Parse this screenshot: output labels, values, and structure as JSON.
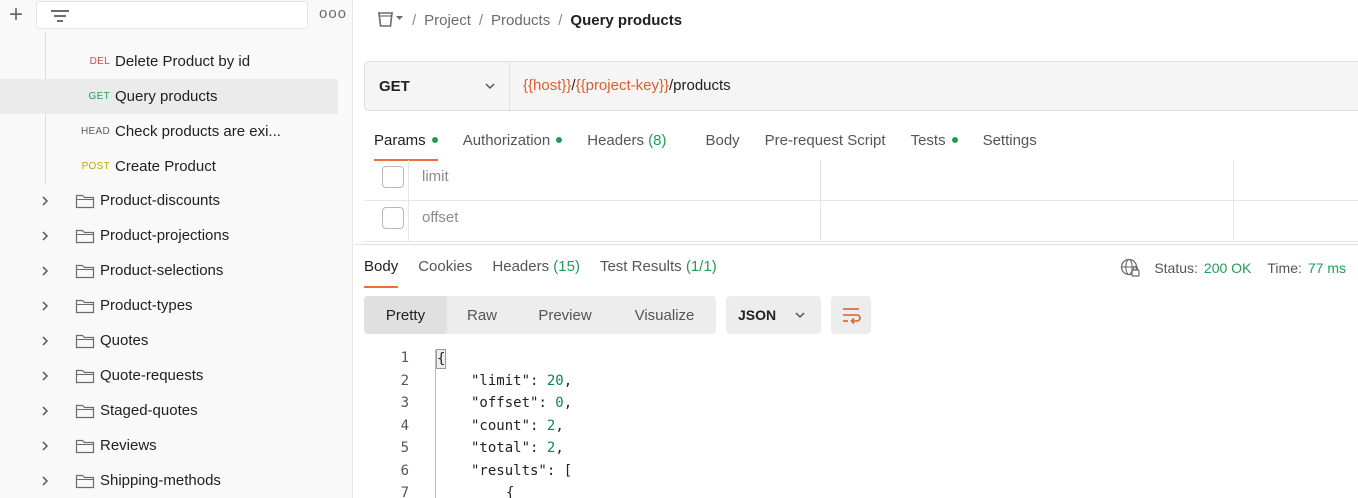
{
  "sidebar": {
    "requests": [
      {
        "method": "DEL",
        "name": "Delete Product by id"
      },
      {
        "method": "GET",
        "name": "Query products"
      },
      {
        "method": "HEAD",
        "name": "Check products are exi..."
      },
      {
        "method": "POST",
        "name": "Create Product"
      }
    ],
    "folders": [
      "Product-discounts",
      "Product-projections",
      "Product-selections",
      "Product-types",
      "Quotes",
      "Quote-requests",
      "Staged-quotes",
      "Reviews",
      "Shipping-methods"
    ]
  },
  "breadcrumb": {
    "items": [
      "Project",
      "Products"
    ],
    "current": "Query products",
    "sep": "/"
  },
  "request": {
    "method": "GET",
    "url_parts": [
      {
        "text": "{{host}}",
        "var": true
      },
      {
        "text": "/",
        "var": false
      },
      {
        "text": "{{project-key}}",
        "var": true
      },
      {
        "text": "/products",
        "var": false
      }
    ]
  },
  "request_tabs": {
    "params": "Params",
    "authorization": "Authorization",
    "headers": "Headers",
    "headers_count": "(8)",
    "body": "Body",
    "prerequest": "Pre-request Script",
    "tests": "Tests",
    "settings": "Settings"
  },
  "params": [
    {
      "key": "limit"
    },
    {
      "key": "offset"
    }
  ],
  "response_tabs": {
    "body": "Body",
    "cookies": "Cookies",
    "headers": "Headers",
    "headers_count": "(15)",
    "tests": "Test Results",
    "tests_count": "(1/1)"
  },
  "status": {
    "status_label": "Status:",
    "status_value": "200 OK",
    "time_label": "Time:",
    "time_value": "77 ms"
  },
  "view_tabs": [
    "Pretty",
    "Raw",
    "Preview",
    "Visualize"
  ],
  "format": "JSON",
  "code": {
    "line_numbers": [
      "1",
      "2",
      "3",
      "4",
      "5",
      "6",
      "7"
    ],
    "brace_open": "{",
    "lines": [
      {
        "key": "\"limit\"",
        "sep": ": ",
        "val": "20",
        "tail": ","
      },
      {
        "key": "\"offset\"",
        "sep": ": ",
        "val": "0",
        "tail": ","
      },
      {
        "key": "\"count\"",
        "sep": ": ",
        "val": "2",
        "tail": ","
      },
      {
        "key": "\"total\"",
        "sep": ": ",
        "val": "2",
        "tail": ","
      },
      {
        "key": "\"results\"",
        "sep": ": ",
        "val": "",
        "tail": "["
      }
    ],
    "line7": "{"
  },
  "colors": {
    "accent": "#f26b3a",
    "get": "#1f9d55",
    "del": "#d64545",
    "post": "#c9a200",
    "variable": "#e05d2c"
  }
}
